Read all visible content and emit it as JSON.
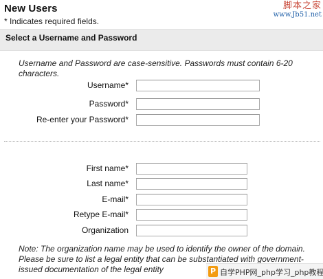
{
  "header": {
    "title": "New Users",
    "required_note": "* Indicates required fields.",
    "watermark_line1": "脚本之家",
    "watermark_line2": "www.Jb51.net"
  },
  "section": {
    "heading": "Select a Username and Password",
    "instructions": "Username and Password are case-sensitive. Passwords must contain 6-20 characters."
  },
  "credentials": {
    "username_label": "Username*",
    "username_value": "",
    "password_label": "Password*",
    "password_value": "",
    "confirm_label": "Re-enter your Password*",
    "confirm_value": ""
  },
  "profile": {
    "first_name_label": "First name*",
    "first_name_value": "",
    "last_name_label": "Last name*",
    "last_name_value": "",
    "email_label": "E-mail*",
    "email_value": "",
    "retype_email_label": "Retype E-mail*",
    "retype_email_value": "",
    "organization_label": "Organization",
    "organization_value": ""
  },
  "org_note": "Note: The organization name may be used to identify the owner of the domain. Please be sure to list a legal entity that can be substantiated with government-issued documentation of the legal entity",
  "banner": {
    "logo_letter": "P",
    "text": "自学PHP网_php学习_php教程"
  }
}
